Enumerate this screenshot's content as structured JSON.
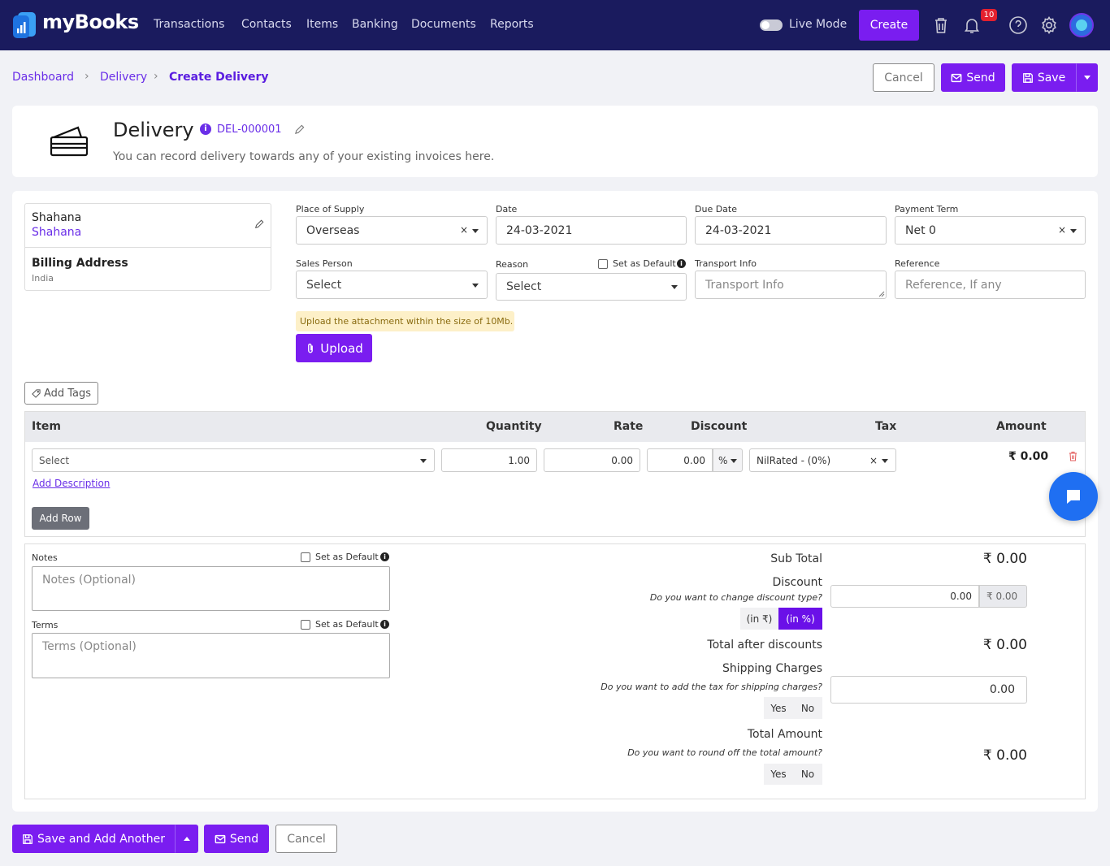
{
  "navbar": {
    "brand": "myBooks",
    "menu": [
      "Transactions",
      "Contacts",
      "Items",
      "Banking",
      "Documents",
      "Reports"
    ],
    "live_mode_label": "Live Mode",
    "create_label": "Create",
    "notifications_count": "10"
  },
  "breadcrumb": {
    "items": [
      "Dashboard",
      "Delivery",
      "Create Delivery"
    ]
  },
  "toolbar": {
    "cancel_label": "Cancel",
    "send_label": "Send",
    "save_label": "Save"
  },
  "header": {
    "title": "Delivery",
    "doc_number": "DEL-000001",
    "subtitle": "You can record delivery towards any of your existing invoices here."
  },
  "customer": {
    "name": "Shahana",
    "link": "Shahana",
    "billing_label": "Billing Address",
    "country": "India"
  },
  "fields": {
    "place_of_supply": {
      "label": "Place of Supply",
      "value": "Overseas"
    },
    "date": {
      "label": "Date",
      "value": "24-03-2021"
    },
    "due_date": {
      "label": "Due Date",
      "value": "24-03-2021"
    },
    "payment_term": {
      "label": "Payment Term",
      "value": "Net 0"
    },
    "sales_person": {
      "label": "Sales Person",
      "placeholder": "Select"
    },
    "reason": {
      "label": "Reason",
      "placeholder": "Select",
      "default_label": "Set as Default"
    },
    "transport_info": {
      "label": "Transport Info",
      "placeholder": "Transport Info"
    },
    "reference": {
      "label": "Reference",
      "placeholder": "Reference, If any"
    }
  },
  "upload": {
    "note": "Upload the attachment within the size of 10Mb.",
    "button": "Upload"
  },
  "tags": {
    "button": "Add Tags"
  },
  "items_table": {
    "headers": [
      "Item",
      "Quantity",
      "Rate",
      "Discount",
      "Tax",
      "Amount"
    ],
    "row": {
      "item_placeholder": "Select",
      "quantity": "1.00",
      "rate": "0.00",
      "discount": "0.00",
      "discount_type": "%",
      "tax": "NilRated - (0%)",
      "amount": "₹ 0.00"
    },
    "add_description": "Add Description",
    "add_row": "Add Row"
  },
  "notes": {
    "label": "Notes",
    "default_label": "Set as Default",
    "placeholder": "Notes (Optional)"
  },
  "terms": {
    "label": "Terms",
    "default_label": "Set as Default",
    "placeholder": "Terms (Optional)"
  },
  "summary": {
    "sub_total_label": "Sub Total",
    "sub_total": "₹ 0.00",
    "discount_label": "Discount",
    "discount_question": "Do you want to change discount type?",
    "discount_value": "0.00",
    "discount_amount": "₹  0.00",
    "discount_type_rupee": "(in ₹)",
    "discount_type_percent": "(in %)",
    "total_after_label": "Total after discounts",
    "total_after": "₹ 0.00",
    "shipping_label": "Shipping Charges",
    "shipping_question": "Do you want to add the tax for shipping charges?",
    "shipping_value": "0.00",
    "yes": "Yes",
    "no": "No",
    "total_label": "Total Amount",
    "round_question": "Do you want to round off the total amount?",
    "total": "₹ 0.00"
  },
  "footer": {
    "save_add_label": "Save and Add Another",
    "send_label": "Send",
    "cancel_label": "Cancel"
  }
}
